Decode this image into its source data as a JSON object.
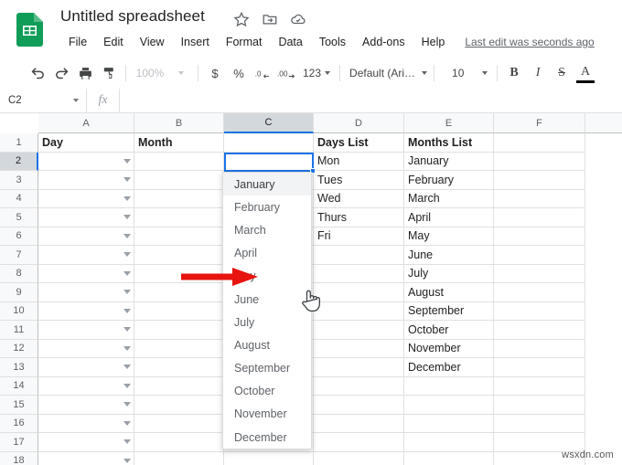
{
  "app": {
    "logo_icon": "google-sheets-logo",
    "doc_title": "Untitled spreadsheet",
    "title_icons": [
      {
        "name": "star-icon",
        "glyph": "star"
      },
      {
        "name": "move-to-folder-icon",
        "glyph": "folder-move"
      },
      {
        "name": "drive-status-icon",
        "glyph": "cloud-check"
      }
    ]
  },
  "menubar": {
    "items": [
      {
        "label": "File"
      },
      {
        "label": "Edit"
      },
      {
        "label": "View"
      },
      {
        "label": "Insert"
      },
      {
        "label": "Format"
      },
      {
        "label": "Data"
      },
      {
        "label": "Tools"
      },
      {
        "label": "Add-ons"
      },
      {
        "label": "Help"
      }
    ],
    "last_edit": "Last edit was seconds ago"
  },
  "toolbar": {
    "undo_icon": "undo-icon",
    "redo_icon": "redo-icon",
    "print_icon": "print-icon",
    "paint_format_icon": "paint-format-icon",
    "zoom_value": "100%",
    "currency_label": "$",
    "percent_label": "%",
    "decimal_decrease_label": ".0",
    "decimal_increase_label": ".00",
    "number_format_label": "123",
    "font_family_value": "Default (Ari…",
    "font_size_value": "10",
    "bold_label": "B",
    "italic_label": "I",
    "strikethrough_label": "S",
    "text_color_label": "A",
    "text_color_swatch": "#000000"
  },
  "formula_bar": {
    "name_box_value": "C2",
    "fx_label": "fx",
    "formula_value": ""
  },
  "grid": {
    "columns": [
      {
        "label": "A",
        "width": 105,
        "selected": false
      },
      {
        "label": "B",
        "width": 98,
        "selected": false
      },
      {
        "label": "C",
        "width": 98,
        "selected": true
      },
      {
        "label": "D",
        "width": 99,
        "selected": false
      },
      {
        "label": "E",
        "width": 98,
        "selected": false
      },
      {
        "label": "F",
        "width": 100,
        "selected": false
      },
      {
        "label": "",
        "width": 42,
        "selected": false
      }
    ],
    "rows": [
      "1",
      "2",
      "3",
      "4",
      "5",
      "6",
      "7",
      "8",
      "9",
      "10",
      "11",
      "12",
      "13",
      "14",
      "15",
      "16",
      "17",
      "18"
    ],
    "selected_row": "2",
    "cells": {
      "A1": "Day",
      "B1": "Month",
      "D1": "Days List",
      "E1": "Months List",
      "D2": "Mon",
      "D3": "Tues",
      "D4": "Wed",
      "D5": "Thurs",
      "D6": "Fri",
      "E2": "January",
      "E3": "February",
      "E4": "March",
      "E5": "April",
      "E6": "May",
      "E7": "June",
      "E8": "July",
      "E9": "August",
      "E10": "September",
      "E11": "October",
      "E12": "November",
      "E13": "December"
    },
    "bold_cells": [
      "A1",
      "B1",
      "D1",
      "E1"
    ],
    "validation_arrow_rows": [
      "2",
      "3",
      "4",
      "5",
      "6",
      "7",
      "8",
      "9",
      "10",
      "11",
      "12",
      "13",
      "14",
      "15",
      "16",
      "17",
      "18"
    ],
    "selected_cell": "C2",
    "selection_color": "#1a73e8"
  },
  "dropdown": {
    "name": "data-validation-dropdown",
    "hovered_index": 0,
    "items": [
      "January",
      "February",
      "March",
      "April",
      "May",
      "June",
      "July",
      "August",
      "September",
      "October",
      "November",
      "December"
    ]
  },
  "annotation": {
    "arrow_color": "#e8140f",
    "arrow_points_to": "C2",
    "cursor_icon": "hand-pointer-cursor"
  },
  "watermark": {
    "text": "wsxdn.com"
  }
}
